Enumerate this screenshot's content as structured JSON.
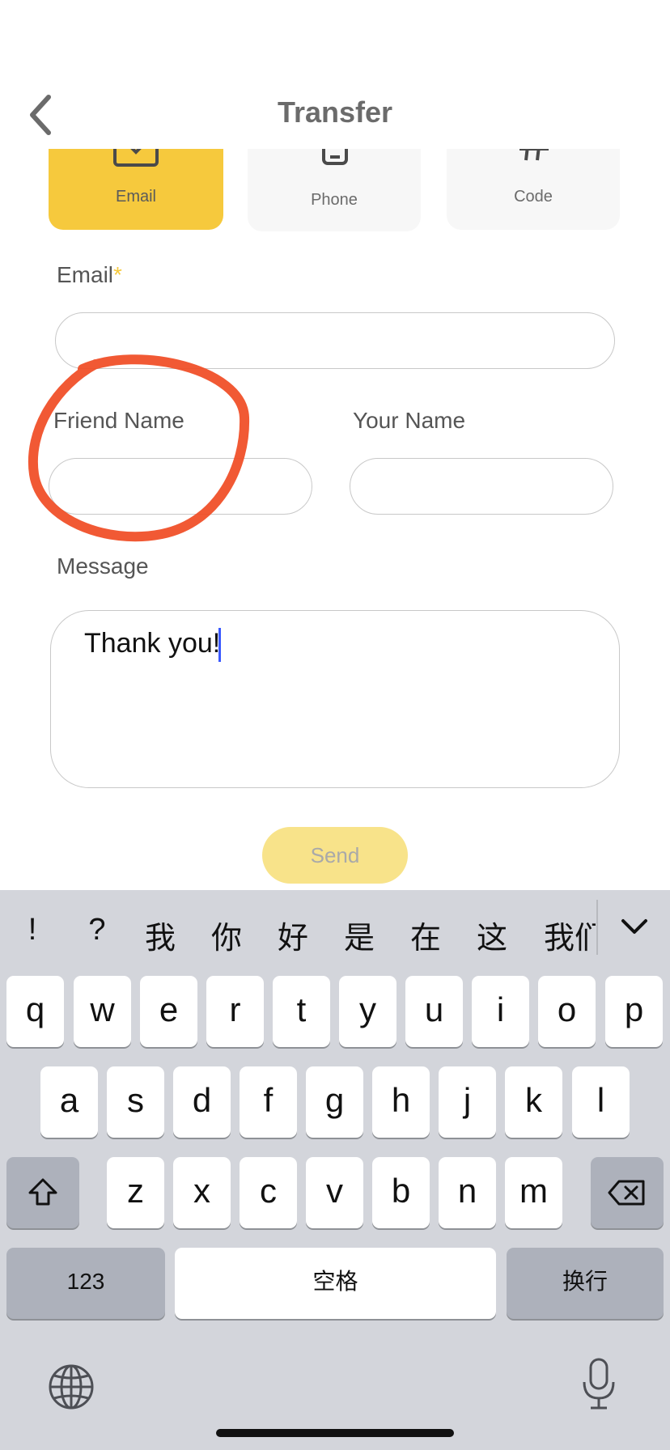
{
  "header": {
    "title": "Transfer"
  },
  "methods": [
    {
      "label": "Email",
      "active": true
    },
    {
      "label": "Phone",
      "active": false
    },
    {
      "label": "Code",
      "active": false
    }
  ],
  "form": {
    "email_label": "Email",
    "required_mark": "*",
    "email_value": "",
    "friend_name_label": "Friend Name",
    "friend_name_value": "",
    "your_name_label": "Your Name",
    "your_name_value": "",
    "message_label": "Message",
    "message_value": "Thank you!",
    "send_label": "Send"
  },
  "keyboard": {
    "candidates": [
      "!",
      "?",
      "我",
      "你",
      "好",
      "是",
      "在",
      "这",
      "我们"
    ],
    "row1": [
      "q",
      "w",
      "e",
      "r",
      "t",
      "y",
      "u",
      "i",
      "o",
      "p"
    ],
    "row2": [
      "a",
      "s",
      "d",
      "f",
      "g",
      "h",
      "j",
      "k",
      "l"
    ],
    "row3": [
      "z",
      "x",
      "c",
      "v",
      "b",
      "n",
      "m"
    ],
    "numbers_label": "123",
    "space_label": "空格",
    "return_label": "换行"
  },
  "colors": {
    "accent": "#f6c93d",
    "send_disabled": "#f8e38a",
    "annotation": "#f04b23",
    "cursor": "#3a59ff"
  },
  "icons": [
    "back-chevron-icon",
    "envelope-icon",
    "phone-icon",
    "hash-icon",
    "shift-icon",
    "backspace-icon",
    "globe-icon",
    "microphone-icon",
    "keyboard-collapse-icon"
  ]
}
